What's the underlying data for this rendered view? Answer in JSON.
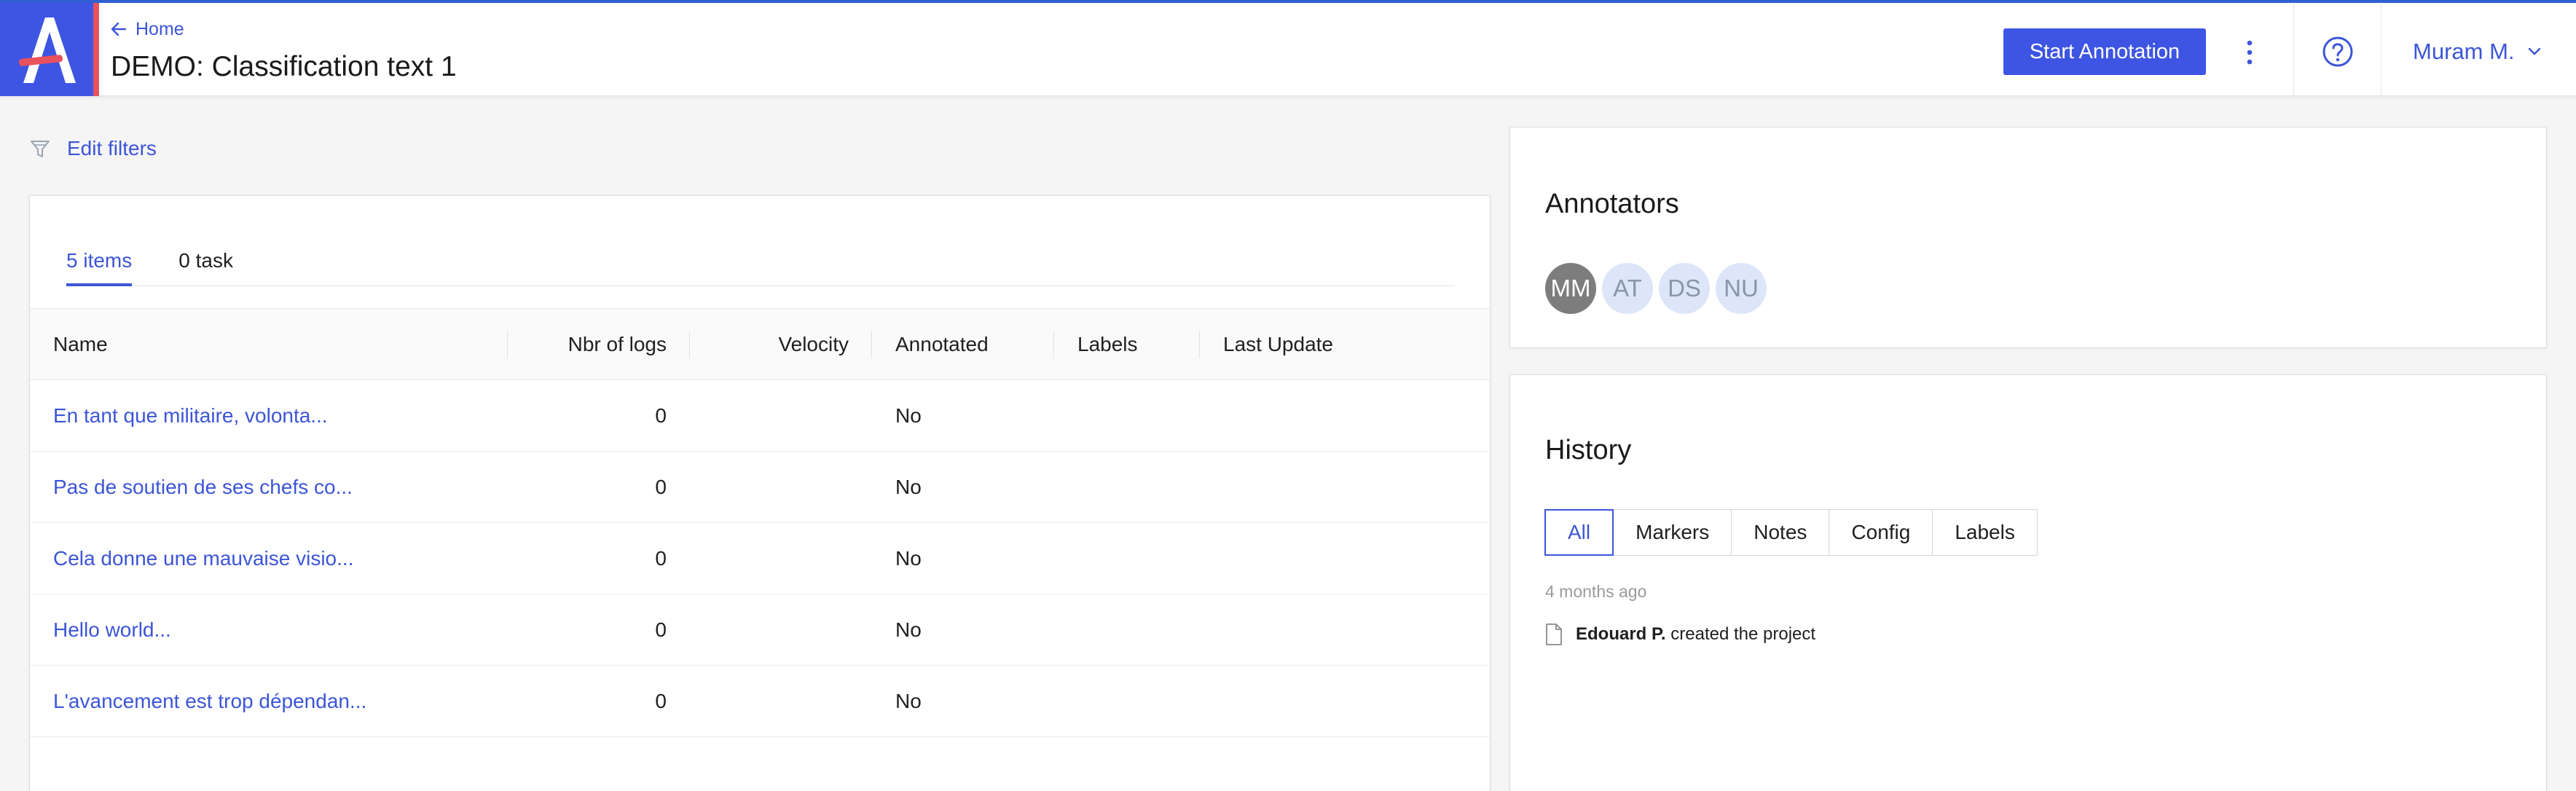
{
  "header": {
    "breadcrumb": "Home",
    "title": "DEMO: Classification text 1",
    "start_button": "Start Annotation",
    "user": "Muram M.",
    "accent_color": "#3e55e3",
    "logo_stripe_color": "#e8515e"
  },
  "filters": {
    "label": "Edit filters"
  },
  "items": {
    "tabs": [
      {
        "label": "5 items",
        "active": true
      },
      {
        "label": "0 task",
        "active": false
      }
    ],
    "columns": [
      "Name",
      "Nbr of logs",
      "Velocity",
      "Annotated",
      "Labels",
      "Last Update"
    ],
    "rows": [
      {
        "name": "En tant que militaire, volonta...",
        "logs": "0",
        "velocity": "",
        "annotated": "No",
        "labels": "",
        "last_update": ""
      },
      {
        "name": "Pas de soutien de ses chefs co...",
        "logs": "0",
        "velocity": "",
        "annotated": "No",
        "labels": "",
        "last_update": ""
      },
      {
        "name": "Cela donne une mauvaise visio...",
        "logs": "0",
        "velocity": "",
        "annotated": "No",
        "labels": "",
        "last_update": ""
      },
      {
        "name": "Hello world...",
        "logs": "0",
        "velocity": "",
        "annotated": "No",
        "labels": "",
        "last_update": ""
      },
      {
        "name": "L'avancement est trop dépendan...",
        "logs": "0",
        "velocity": "",
        "annotated": "No",
        "labels": "",
        "last_update": ""
      }
    ]
  },
  "annotators": {
    "title": "Annotators",
    "people": [
      "MM",
      "AT",
      "DS",
      "NU"
    ]
  },
  "history": {
    "title": "History",
    "filters": [
      "All",
      "Markers",
      "Notes",
      "Config",
      "Labels"
    ],
    "active_filter": "All",
    "time": "4 months ago",
    "entry_user": "Edouard P.",
    "entry_text": "created the project"
  }
}
